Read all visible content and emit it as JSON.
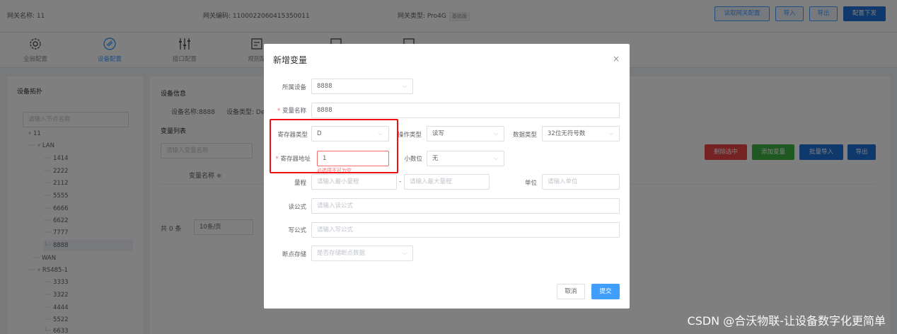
{
  "header": {
    "gateway_name": "网关名称: 11",
    "gateway_code": "网关编码: 1100022060415350011",
    "gateway_type": "网关类型: Pro4G",
    "gateway_type_tag": "基础版",
    "buttons": {
      "read_config": "读取网关配置",
      "import": "导入",
      "export": "导出",
      "deploy": "配置下发"
    }
  },
  "nav": {
    "items": [
      {
        "label": "全局配置",
        "icon": "gear-icon"
      },
      {
        "label": "设备配置",
        "icon": "device-config-icon"
      },
      {
        "label": "接口配置",
        "icon": "sliders-icon"
      },
      {
        "label": "规则配",
        "icon": "rule-icon"
      },
      {
        "label": "",
        "icon": "code-icon"
      },
      {
        "label": "",
        "icon": "monitor-icon"
      }
    ]
  },
  "left": {
    "title": "设备拓扑",
    "search_placeholder": "请输入节点名称",
    "tree": [
      {
        "label": "11",
        "prefix": "▾"
      },
      {
        "label": "LAN",
        "prefix": "┈┈ ▾"
      },
      {
        "label": "1414",
        "prefix": "┈┈"
      },
      {
        "label": "2222",
        "prefix": "┈┈"
      },
      {
        "label": "2112",
        "prefix": "┈┈"
      },
      {
        "label": "5555",
        "prefix": "┈┈"
      },
      {
        "label": "6666",
        "prefix": "┈┈"
      },
      {
        "label": "6622",
        "prefix": "┈┈"
      },
      {
        "label": "7777",
        "prefix": "┈┈"
      },
      {
        "label": "8888",
        "prefix": "└┈"
      },
      {
        "label": "WAN",
        "prefix": "┈┈"
      },
      {
        "label": "RS485-1",
        "prefix": "┈┈ ▾"
      },
      {
        "label": "3333",
        "prefix": "┈┈"
      },
      {
        "label": "3322",
        "prefix": "┈┈"
      },
      {
        "label": "4444",
        "prefix": "┈┈"
      },
      {
        "label": "5522",
        "prefix": "┈┈"
      },
      {
        "label": "6633",
        "prefix": "└┈"
      }
    ]
  },
  "right": {
    "device_info_title": "设备信息",
    "device_name": "设备名称:8888",
    "device_type": "设备类型: De",
    "var_list_title": "变量列表",
    "var_search_placeholder": "请输入变量名称",
    "col_var_name": "变量名称 ≑",
    "total": "共 0 条",
    "page_size": "10条/页",
    "buttons": {
      "delete_selected": "删除选中",
      "add_var": "添加变量",
      "batch_import": "批量导入",
      "export": "导出"
    }
  },
  "dialog": {
    "title": "新增变量",
    "close": "×",
    "fields": {
      "device": {
        "label": "所属设备",
        "value": "8888"
      },
      "var_name": {
        "label": "变量名称",
        "value": "8888"
      },
      "reg_type": {
        "label": "寄存器类型",
        "value": "D"
      },
      "op_type": {
        "label": "操作类型",
        "value": "读写"
      },
      "data_type": {
        "label": "数据类型",
        "value": "32位无符号数"
      },
      "reg_addr": {
        "label": "寄存器地址",
        "value": "1",
        "error": "必选项不可为空"
      },
      "decimal": {
        "label": "小数位",
        "value": "无"
      },
      "range": {
        "label": "量程",
        "min_placeholder": "请输入最小量程",
        "sep": "-",
        "max_placeholder": "请输入最大量程"
      },
      "unit": {
        "label": "单位",
        "placeholder": "请输入单位"
      },
      "read_formula": {
        "label": "读公式",
        "placeholder": "请输入读公式"
      },
      "write_formula": {
        "label": "写公式",
        "placeholder": "请输入写公式"
      },
      "breakpoint": {
        "label": "断点存储",
        "placeholder": "是否存储断点数据"
      }
    },
    "buttons": {
      "cancel": "取消",
      "submit": "提交"
    }
  },
  "watermark": "CSDN @合沃物联-让设备数字化更简单",
  "colors": {
    "primary": "#409eff",
    "danger": "#e84545",
    "success": "#3eb142",
    "highlight": "#e11111"
  }
}
